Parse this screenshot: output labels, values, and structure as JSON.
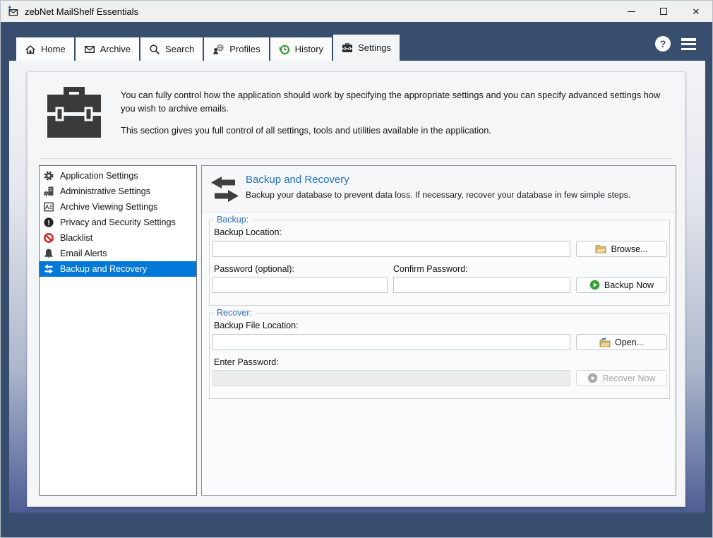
{
  "window": {
    "title": "zebNet MailShelf Essentials"
  },
  "tabs": [
    {
      "label": "Home",
      "icon": "home-icon"
    },
    {
      "label": "Archive",
      "icon": "envelope-icon"
    },
    {
      "label": "Search",
      "icon": "magnifier-icon"
    },
    {
      "label": "Profiles",
      "icon": "profiles-globe-icon"
    },
    {
      "label": "History",
      "icon": "history-clock-icon"
    },
    {
      "label": "Settings",
      "icon": "toolbox-icon",
      "active": true
    }
  ],
  "help_button": {
    "glyph": "?"
  },
  "intro": {
    "paragraph1": "You can fully control how the application should work by specifying the appropriate settings and you can specify advanced settings how you wish to archive emails.",
    "paragraph2": "This section gives you full control of all settings, tools and utilities available in the application."
  },
  "sidebar": {
    "items": [
      {
        "label": "Application Settings",
        "icon": "gear-icon"
      },
      {
        "label": "Administrative Settings",
        "icon": "admin-gear-document-icon"
      },
      {
        "label": "Archive Viewing Settings",
        "icon": "document-preview-icon"
      },
      {
        "label": "Privacy and Security Settings",
        "icon": "exclamation-badge-icon"
      },
      {
        "label": "Blacklist",
        "icon": "prohibition-icon"
      },
      {
        "label": "Email Alerts",
        "icon": "bell-icon"
      },
      {
        "label": "Backup and Recovery",
        "icon": "sync-arrows-icon",
        "selected": true
      }
    ]
  },
  "panel": {
    "title": "Backup and Recovery",
    "subtitle": "Backup your database to prevent data loss. If necessary, recover your database in few simple steps."
  },
  "backup_group": {
    "legend": "Backup:",
    "backup_location_label": "Backup Location:",
    "backup_location_value": "",
    "browse_button": "Browse...",
    "password_label": "Password (optional):",
    "password_value": "",
    "confirm_password_label": "Confirm Password:",
    "confirm_password_value": "",
    "backup_now_button": "Backup Now"
  },
  "recover_group": {
    "legend": "Recover:",
    "backup_file_location_label": "Backup File Location:",
    "backup_file_location_value": "",
    "open_button": "Open...",
    "enter_password_label": "Enter Password:",
    "enter_password_value": "",
    "recover_now_button": "Recover Now",
    "recover_now_enabled": false
  },
  "colors": {
    "accent_selection": "#0078d7",
    "frame_navy": "#374e6e",
    "title_blue": "#1d72ba",
    "group_label_blue": "#2c6cb5"
  }
}
